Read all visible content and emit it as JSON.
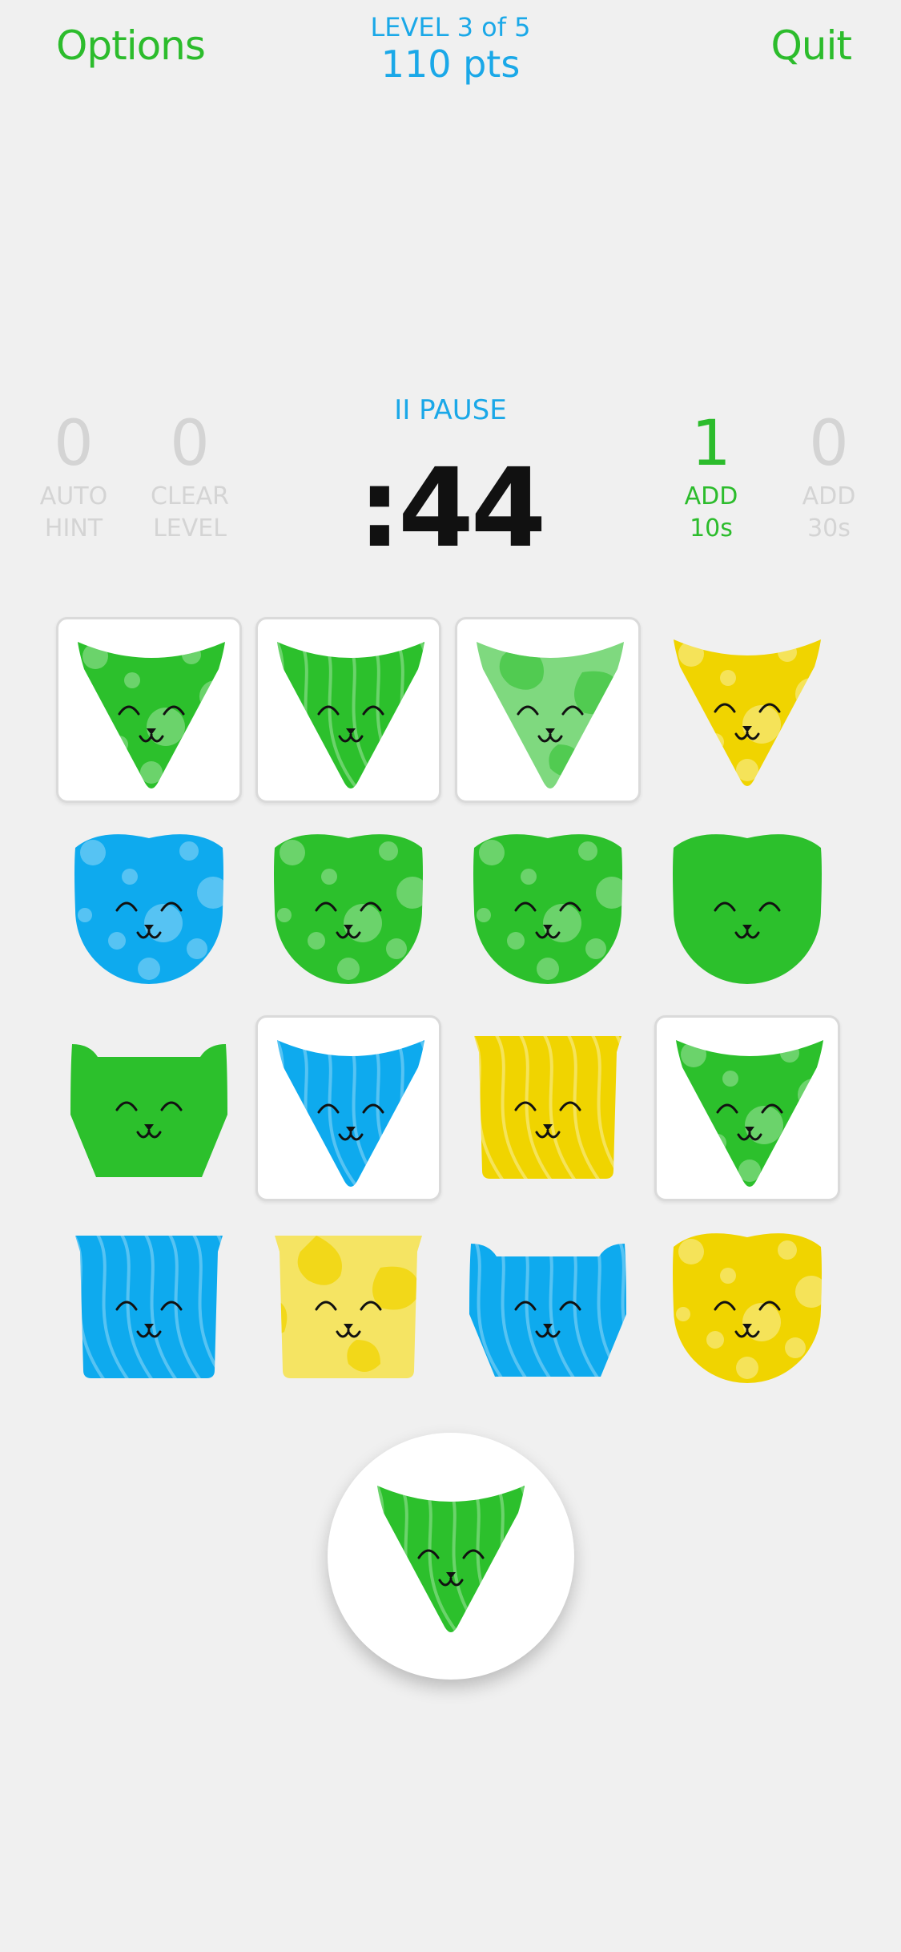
{
  "header": {
    "options_label": "Options",
    "quit_label": "Quit",
    "level_text": "LEVEL 3 of 5",
    "points_text": "110 pts"
  },
  "pause_label": "II PAUSE",
  "timer": ":44",
  "powerups": [
    {
      "count": "0",
      "label1": "AUTO",
      "label2": "HINT",
      "active": false
    },
    {
      "count": "0",
      "label1": "CLEAR",
      "label2": "LEVEL",
      "active": false
    },
    {
      "count": "1",
      "label1": "ADD",
      "label2": "10s",
      "active": true
    },
    {
      "count": "0",
      "label1": "ADD",
      "label2": "30s",
      "active": false
    }
  ],
  "colors": {
    "green": "#2cc02c",
    "blue": "#0eaaee",
    "yellow": "#f0d400",
    "lightgreen": "#7fd97f",
    "lightyellow": "#f5e463",
    "accent_green": "#2cbc2c",
    "accent_blue": "#1aa8e8"
  },
  "grid": [
    [
      {
        "shape": "tri",
        "color": "green",
        "pattern": "dots",
        "selected": true
      },
      {
        "shape": "tri",
        "color": "green",
        "pattern": "waves",
        "selected": true
      },
      {
        "shape": "tri",
        "color": "lightgreen",
        "pattern": "patches",
        "selected": true
      },
      {
        "shape": "tri",
        "color": "yellow",
        "pattern": "dots",
        "selected": false
      }
    ],
    [
      {
        "shape": "round",
        "color": "blue",
        "pattern": "dots",
        "selected": false
      },
      {
        "shape": "round",
        "color": "green",
        "pattern": "dots",
        "selected": false
      },
      {
        "shape": "round",
        "color": "green",
        "pattern": "dots",
        "selected": false
      },
      {
        "shape": "round",
        "color": "green",
        "pattern": "solid",
        "selected": false
      }
    ],
    [
      {
        "shape": "angular",
        "color": "green",
        "pattern": "solid",
        "selected": false
      },
      {
        "shape": "tri",
        "color": "blue",
        "pattern": "waves",
        "selected": true
      },
      {
        "shape": "square",
        "color": "yellow",
        "pattern": "waves",
        "selected": false
      },
      {
        "shape": "tri",
        "color": "green",
        "pattern": "dots",
        "selected": true
      }
    ],
    [
      {
        "shape": "square",
        "color": "blue",
        "pattern": "waves",
        "selected": false
      },
      {
        "shape": "square",
        "color": "lightyellow",
        "pattern": "patches",
        "selected": false
      },
      {
        "shape": "angular",
        "color": "blue",
        "pattern": "waves",
        "selected": false
      },
      {
        "shape": "round",
        "color": "yellow",
        "pattern": "dots",
        "selected": false
      }
    ]
  ],
  "current_piece": {
    "shape": "tri",
    "color": "green",
    "pattern": "waves"
  }
}
